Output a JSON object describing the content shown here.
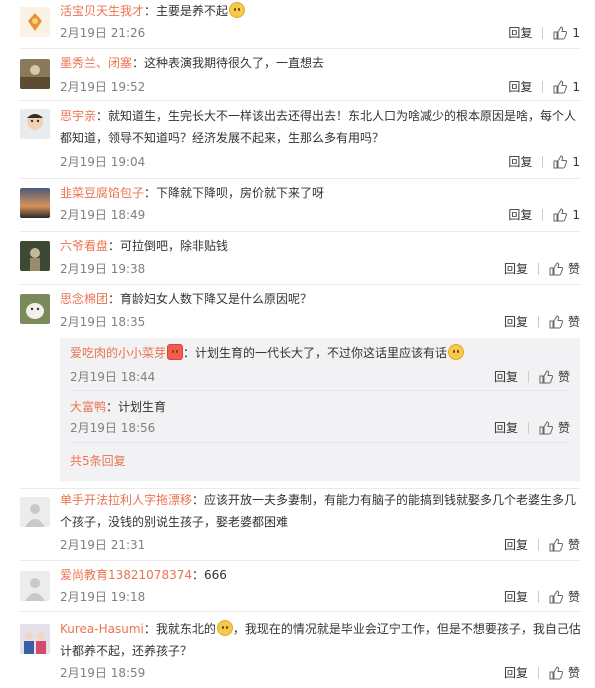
{
  "labels": {
    "reply": "回复",
    "like": "赞",
    "more_replies": "共5条回复"
  },
  "comments": [
    {
      "name": "活宝贝天生我才",
      "text": "：主要是养不起",
      "date": "2月19日 21:26",
      "likes": "1"
    },
    {
      "name": "墨秀兰、闭塞",
      "text": "：这种表演我期待很久了，一直想去",
      "date": "2月19日 19:52",
      "likes": "1"
    },
    {
      "name": "思宇亲",
      "text": "：就知道生，生完长大不一样该出去还得出去！东北人口为啥减少的根本原因是啥，每个人都知道，领导不知道吗？经济发展不起来，生那么多有用吗？",
      "date": "2月19日 19:04",
      "likes": "1"
    },
    {
      "name": "韭菜豆腐馅包子",
      "text": "：下降就下降呗，房价就下来了呀",
      "date": "2月19日 18:49",
      "likes": "1"
    },
    {
      "name": "六爷看盘",
      "text": "：可拉倒吧，除非贴钱",
      "date": "2月19日 19:38",
      "likes": "赞"
    },
    {
      "name": "思念棉团",
      "text": "：育龄妇女人数下降又是什么原因呢？",
      "date": "2月19日 18:35",
      "likes": "赞"
    },
    {
      "name": "单手开法拉利人字拖漂移",
      "text": "：应该开放一夫多妻制，有能力有脑子的能搞到钱就娶多几个老婆生多几个孩子，没钱的别说生孩子，娶老婆都困难",
      "date": "2月19日 21:31",
      "likes": "赞"
    },
    {
      "name": "爱尚教育13821078374",
      "text": "：666",
      "date": "2月19日 19:18",
      "likes": "赞"
    },
    {
      "name": "Kurea-Hasumi",
      "text_a": "：我就东北的",
      "text_b": "，我现在的情况就是毕业会辽宁工作，但是不想要孩子，我自己估计都养不起，还养孩子？",
      "date": "2月19日 18:59",
      "likes": "赞"
    }
  ],
  "sub_replies": [
    {
      "name": "爱吃肉的小小菜芽",
      "text": "：计划生育的一代长大了，不过你这话里应该有话",
      "date": "2月19日 18:44",
      "likes": "赞"
    },
    {
      "name": "大富鸭",
      "text": "：计划生育",
      "date": "2月19日 18:56",
      "likes": "赞"
    }
  ]
}
